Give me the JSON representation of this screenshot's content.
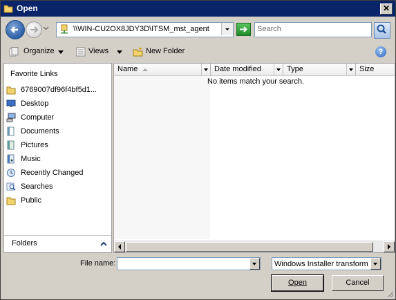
{
  "window": {
    "title": "Open",
    "close_glyph": "✕"
  },
  "nav": {
    "address": "\\\\WIN-CU2OX8JDY3D\\ITSM_mst_agent",
    "search_placeholder": "Search"
  },
  "toolbar": {
    "organize": "Organize",
    "views": "Views",
    "new_folder": "New Folder",
    "help": "?"
  },
  "sidebar": {
    "heading": "Favorite Links",
    "items": [
      {
        "label": "6769007df96f4bf5d1...",
        "icon": "folder-icon"
      },
      {
        "label": "Desktop",
        "icon": "desktop-icon"
      },
      {
        "label": "Computer",
        "icon": "computer-icon"
      },
      {
        "label": "Documents",
        "icon": "documents-icon"
      },
      {
        "label": "Pictures",
        "icon": "pictures-icon"
      },
      {
        "label": "Music",
        "icon": "music-icon"
      },
      {
        "label": "Recently Changed",
        "icon": "recently-changed-icon"
      },
      {
        "label": "Searches",
        "icon": "searches-icon"
      },
      {
        "label": "Public",
        "icon": "folder-icon"
      }
    ],
    "folders_label": "Folders"
  },
  "list": {
    "columns": [
      "Name",
      "Date modified",
      "Type",
      "Size"
    ],
    "empty_message": "No items match your search."
  },
  "footer": {
    "file_name_label": "File name:",
    "file_name_value": "",
    "file_type": "Windows Installer transform p",
    "open_label": "Open",
    "cancel_label": "Cancel"
  }
}
